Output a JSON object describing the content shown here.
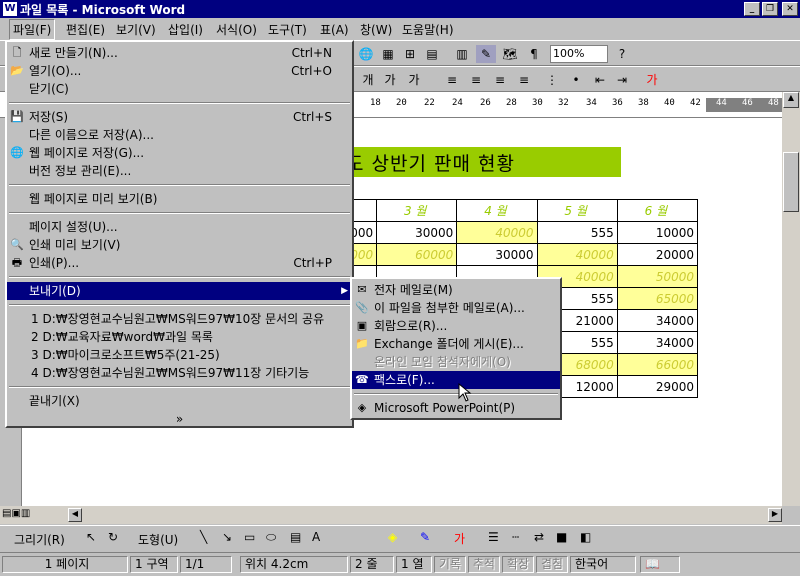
{
  "window": {
    "title": "과일 목록 - Microsoft Word",
    "icon": "W"
  },
  "menubar": [
    "파일(F)",
    "편집(E)",
    "보기(V)",
    "삽입(I)",
    "서식(O)",
    "도구(T)",
    "표(A)",
    "창(W)",
    "도움말(H)"
  ],
  "toolbar": {
    "zoom": "100%"
  },
  "ruler": [
    "18",
    "20",
    "22",
    "24",
    "26",
    "28",
    "30",
    "32",
    "34",
    "36",
    "38",
    "40",
    "42",
    "44",
    "46",
    "48"
  ],
  "document": {
    "title": "도 상반기 판매 현황",
    "headers": [
      "3 월",
      "4 월",
      "5 월",
      "6 월"
    ],
    "rows": [
      [
        "0000",
        "30000",
        "40000",
        "555",
        "10000"
      ],
      [
        "000",
        "60000",
        "30000",
        "40000",
        "20000"
      ],
      [
        "",
        "",
        "",
        "40000",
        "50000"
      ],
      [
        "",
        "",
        "",
        "555",
        "65000"
      ],
      [
        "",
        "",
        "",
        "21000",
        "34000"
      ],
      [
        "",
        "",
        "",
        "555",
        "34000"
      ],
      [
        "",
        "",
        "",
        "68000",
        "66000"
      ],
      [
        "",
        "",
        "",
        "12000",
        "29000"
      ]
    ]
  },
  "file_menu": {
    "items": [
      {
        "label": "새로 만들기(N)...",
        "shortcut": "Ctrl+N",
        "icon": "new-document-icon"
      },
      {
        "label": "열기(O)...",
        "shortcut": "Ctrl+O",
        "icon": "folder-open-icon"
      },
      {
        "label": "닫기(C)",
        "shortcut": ""
      },
      {
        "label": "저장(S)",
        "shortcut": "Ctrl+S",
        "icon": "save-icon"
      },
      {
        "label": "다른 이름으로 저장(A)...",
        "shortcut": ""
      },
      {
        "label": "웹 페이지로 저장(G)...",
        "shortcut": "",
        "icon": "web-save-icon"
      },
      {
        "label": "버전 정보 관리(E)...",
        "shortcut": ""
      },
      {
        "label": "웹 페이지로 미리 보기(B)",
        "shortcut": ""
      },
      {
        "label": "페이지 설정(U)...",
        "shortcut": ""
      },
      {
        "label": "인쇄 미리 보기(V)",
        "shortcut": "",
        "icon": "print-preview-icon"
      },
      {
        "label": "인쇄(P)...",
        "shortcut": "Ctrl+P",
        "icon": "printer-icon"
      },
      {
        "label": "보내기(D)",
        "shortcut": ""
      },
      {
        "label": "1 D:₩장영현교수님원고₩MS워드97₩10장 문서의 공유",
        "shortcut": ""
      },
      {
        "label": "2 D:₩교육자료₩word₩과일 목록",
        "shortcut": ""
      },
      {
        "label": "3 D:₩마이크로소프트₩5주(21-25)",
        "shortcut": ""
      },
      {
        "label": "4 D:₩장영현교수님원고₩MS워드97₩11장 기타기능",
        "shortcut": ""
      },
      {
        "label": "끝내기(X)",
        "shortcut": ""
      }
    ],
    "expand": "»"
  },
  "send_menu": {
    "items": [
      {
        "label": "전자 메일로(M)"
      },
      {
        "label": "이 파일을 첨부한 메일로(A)..."
      },
      {
        "label": "회람으로(R)..."
      },
      {
        "label": "Exchange 폴더에 게시(E)..."
      },
      {
        "label": "온라인 모임 참석자에게(O)"
      },
      {
        "label": "팩스로(F)..."
      },
      {
        "label": "Microsoft PowerPoint(P)"
      }
    ]
  },
  "drawing": {
    "draw": "그리기(R)",
    "autoshape": "도형(U)"
  },
  "status": [
    "1 페이지",
    "1 구역",
    "1/1",
    "위치 4.2cm",
    "2 줄",
    "1 열",
    "기록",
    "추적",
    "확장",
    "겹침",
    "한국어"
  ]
}
